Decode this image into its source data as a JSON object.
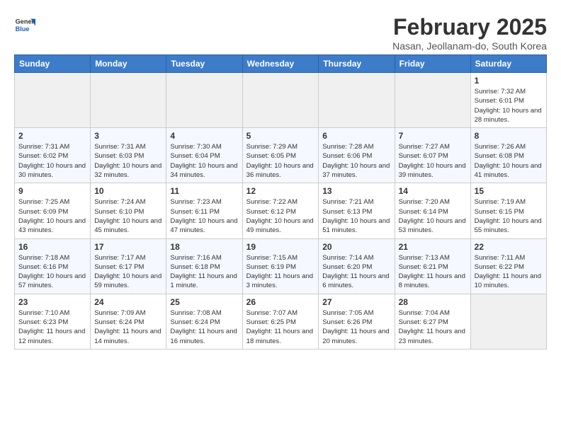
{
  "logo": {
    "general": "General",
    "blue": "Blue"
  },
  "title": "February 2025",
  "location": "Nasan, Jeollanam-do, South Korea",
  "days_of_week": [
    "Sunday",
    "Monday",
    "Tuesday",
    "Wednesday",
    "Thursday",
    "Friday",
    "Saturday"
  ],
  "weeks": [
    [
      {
        "day": "",
        "info": ""
      },
      {
        "day": "",
        "info": ""
      },
      {
        "day": "",
        "info": ""
      },
      {
        "day": "",
        "info": ""
      },
      {
        "day": "",
        "info": ""
      },
      {
        "day": "",
        "info": ""
      },
      {
        "day": "1",
        "info": "Sunrise: 7:32 AM\nSunset: 6:01 PM\nDaylight: 10 hours and 28 minutes."
      }
    ],
    [
      {
        "day": "2",
        "info": "Sunrise: 7:31 AM\nSunset: 6:02 PM\nDaylight: 10 hours and 30 minutes."
      },
      {
        "day": "3",
        "info": "Sunrise: 7:31 AM\nSunset: 6:03 PM\nDaylight: 10 hours and 32 minutes."
      },
      {
        "day": "4",
        "info": "Sunrise: 7:30 AM\nSunset: 6:04 PM\nDaylight: 10 hours and 34 minutes."
      },
      {
        "day": "5",
        "info": "Sunrise: 7:29 AM\nSunset: 6:05 PM\nDaylight: 10 hours and 36 minutes."
      },
      {
        "day": "6",
        "info": "Sunrise: 7:28 AM\nSunset: 6:06 PM\nDaylight: 10 hours and 37 minutes."
      },
      {
        "day": "7",
        "info": "Sunrise: 7:27 AM\nSunset: 6:07 PM\nDaylight: 10 hours and 39 minutes."
      },
      {
        "day": "8",
        "info": "Sunrise: 7:26 AM\nSunset: 6:08 PM\nDaylight: 10 hours and 41 minutes."
      }
    ],
    [
      {
        "day": "9",
        "info": "Sunrise: 7:25 AM\nSunset: 6:09 PM\nDaylight: 10 hours and 43 minutes."
      },
      {
        "day": "10",
        "info": "Sunrise: 7:24 AM\nSunset: 6:10 PM\nDaylight: 10 hours and 45 minutes."
      },
      {
        "day": "11",
        "info": "Sunrise: 7:23 AM\nSunset: 6:11 PM\nDaylight: 10 hours and 47 minutes."
      },
      {
        "day": "12",
        "info": "Sunrise: 7:22 AM\nSunset: 6:12 PM\nDaylight: 10 hours and 49 minutes."
      },
      {
        "day": "13",
        "info": "Sunrise: 7:21 AM\nSunset: 6:13 PM\nDaylight: 10 hours and 51 minutes."
      },
      {
        "day": "14",
        "info": "Sunrise: 7:20 AM\nSunset: 6:14 PM\nDaylight: 10 hours and 53 minutes."
      },
      {
        "day": "15",
        "info": "Sunrise: 7:19 AM\nSunset: 6:15 PM\nDaylight: 10 hours and 55 minutes."
      }
    ],
    [
      {
        "day": "16",
        "info": "Sunrise: 7:18 AM\nSunset: 6:16 PM\nDaylight: 10 hours and 57 minutes."
      },
      {
        "day": "17",
        "info": "Sunrise: 7:17 AM\nSunset: 6:17 PM\nDaylight: 10 hours and 59 minutes."
      },
      {
        "day": "18",
        "info": "Sunrise: 7:16 AM\nSunset: 6:18 PM\nDaylight: 11 hours and 1 minute."
      },
      {
        "day": "19",
        "info": "Sunrise: 7:15 AM\nSunset: 6:19 PM\nDaylight: 11 hours and 3 minutes."
      },
      {
        "day": "20",
        "info": "Sunrise: 7:14 AM\nSunset: 6:20 PM\nDaylight: 11 hours and 6 minutes."
      },
      {
        "day": "21",
        "info": "Sunrise: 7:13 AM\nSunset: 6:21 PM\nDaylight: 11 hours and 8 minutes."
      },
      {
        "day": "22",
        "info": "Sunrise: 7:11 AM\nSunset: 6:22 PM\nDaylight: 11 hours and 10 minutes."
      }
    ],
    [
      {
        "day": "23",
        "info": "Sunrise: 7:10 AM\nSunset: 6:23 PM\nDaylight: 11 hours and 12 minutes."
      },
      {
        "day": "24",
        "info": "Sunrise: 7:09 AM\nSunset: 6:24 PM\nDaylight: 11 hours and 14 minutes."
      },
      {
        "day": "25",
        "info": "Sunrise: 7:08 AM\nSunset: 6:24 PM\nDaylight: 11 hours and 16 minutes."
      },
      {
        "day": "26",
        "info": "Sunrise: 7:07 AM\nSunset: 6:25 PM\nDaylight: 11 hours and 18 minutes."
      },
      {
        "day": "27",
        "info": "Sunrise: 7:05 AM\nSunset: 6:26 PM\nDaylight: 11 hours and 20 minutes."
      },
      {
        "day": "28",
        "info": "Sunrise: 7:04 AM\nSunset: 6:27 PM\nDaylight: 11 hours and 23 minutes."
      },
      {
        "day": "",
        "info": ""
      }
    ]
  ]
}
